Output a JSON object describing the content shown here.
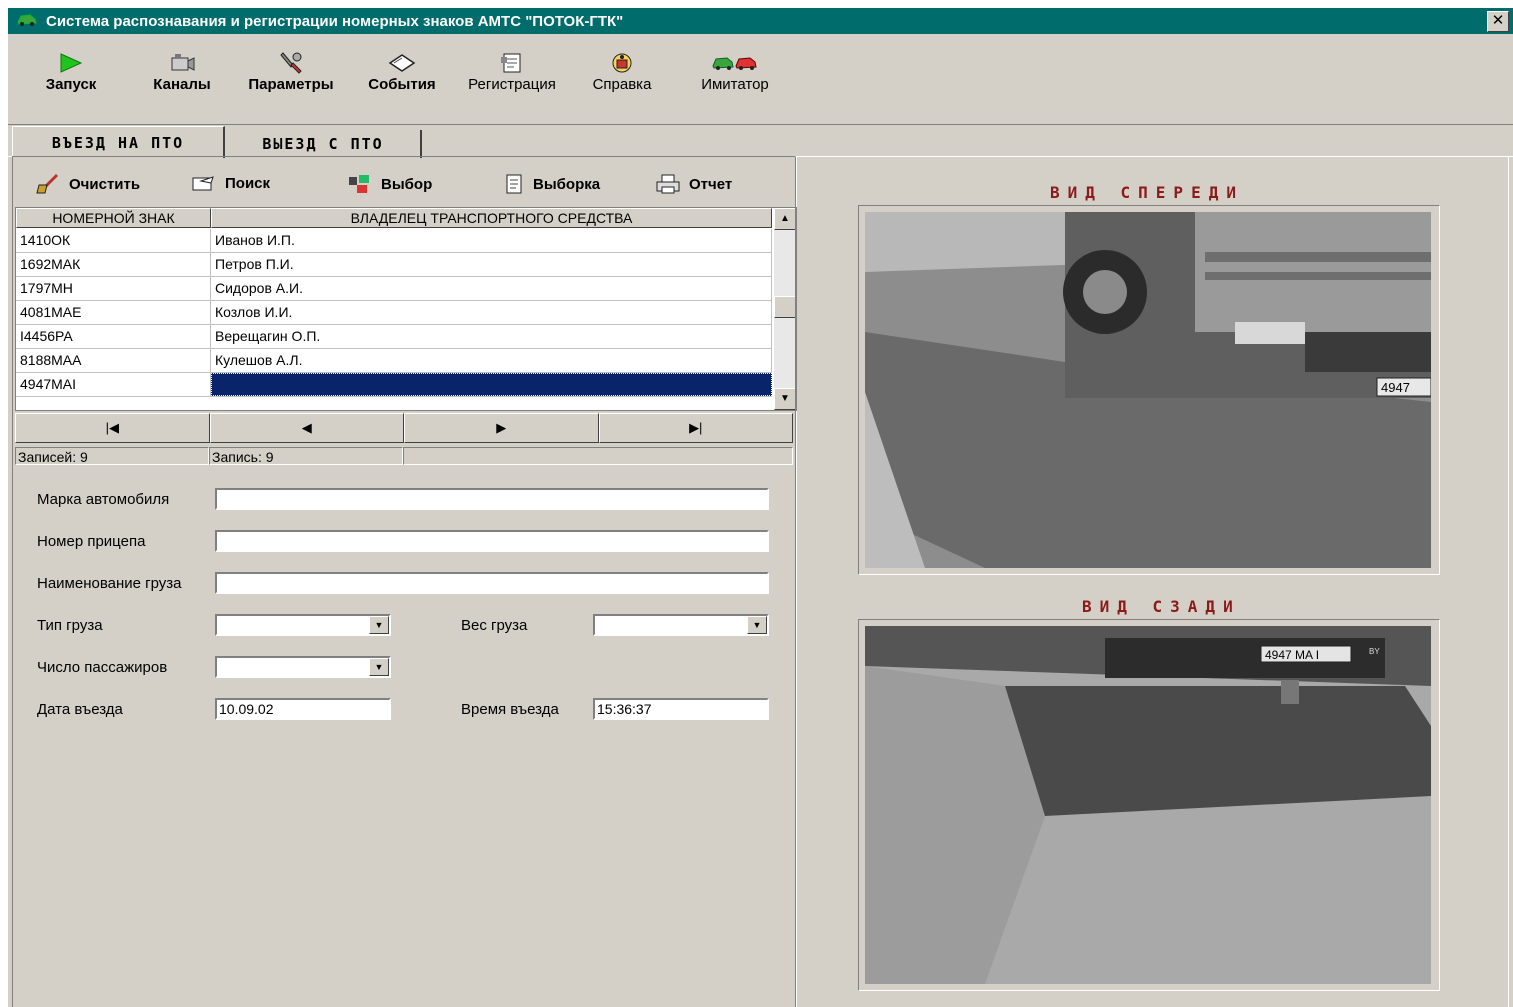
{
  "window": {
    "title": "Система распознавания и регистрации номерных знаков АМТС \"ПОТОК-ГТК\"",
    "close": "✕"
  },
  "toolbar": {
    "start": "Запуск",
    "channels": "Каналы",
    "params": "Параметры",
    "events": "События",
    "registration": "Регистрация",
    "help": "Справка",
    "simulator": "Имитатор"
  },
  "tabs": {
    "entry": "ВЪЕЗД НА ПТО",
    "exit": "ВЫЕЗД С ПТО"
  },
  "subtoolbar": {
    "clear": "Очистить",
    "search": "Поиск",
    "choose": "Выбор",
    "selection": "Выборка",
    "report": "Отчет"
  },
  "grid": {
    "columns": [
      "НОМЕРНОЙ ЗНАК",
      "ВЛАДЕЛЕЦ ТРАНСПОРТНОГО СРЕДСТВА"
    ],
    "rows": [
      {
        "plate": "1410ОК",
        "owner": "Иванов И.П."
      },
      {
        "plate": "1692МАК",
        "owner": "Петров П.И."
      },
      {
        "plate": "1797МН",
        "owner": "Сидоров А.И."
      },
      {
        "plate": "4081МАЕ",
        "owner": "Козлов И.И."
      },
      {
        "plate": "I4456РА",
        "owner": "Верещагин О.П."
      },
      {
        "plate": "8188МАА",
        "owner": "Кулешов А.Л."
      },
      {
        "plate": "4947МАI",
        "owner": ""
      }
    ]
  },
  "nav": {
    "first": "|◀",
    "prev": "◀",
    "next": "▶",
    "last": "▶|"
  },
  "status": {
    "records": "Записей: 9",
    "record": "Запись: 9"
  },
  "form": {
    "car_brand": {
      "label": "Марка автомобиля",
      "value": ""
    },
    "trailer": {
      "label": "Номер прицепа",
      "value": ""
    },
    "cargo_name": {
      "label": "Наименование груза",
      "value": ""
    },
    "cargo_type": {
      "label": "Тип груза",
      "value": ""
    },
    "cargo_weight": {
      "label": "Вес груза",
      "value": ""
    },
    "passengers": {
      "label": "Число пассажиров",
      "value": ""
    },
    "entry_date": {
      "label": "Дата въезда",
      "value": "10.09.02"
    },
    "entry_time": {
      "label": "Время въезда",
      "value": "15:36:37"
    }
  },
  "views": {
    "front": "ВИД СПЕРЕДИ",
    "rear": "ВИД СЗАДИ",
    "front_plate": "4947",
    "rear_plate": "4947 MA I",
    "rear_country": "BY"
  },
  "colors": {
    "titlebar": "#006c6c",
    "selection": "#0a246a",
    "view_title": "#8b1a1a"
  }
}
